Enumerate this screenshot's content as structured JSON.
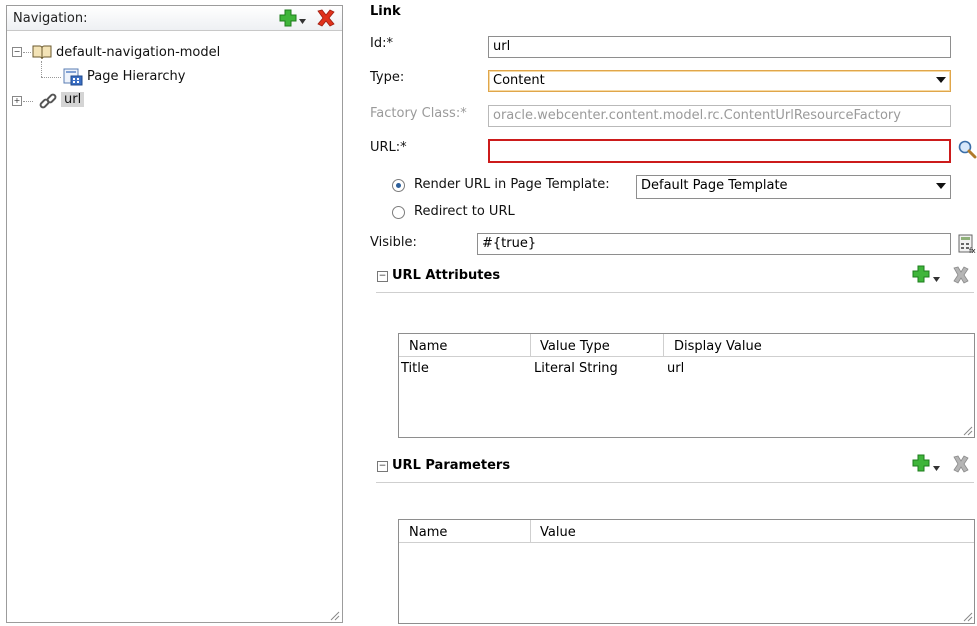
{
  "nav": {
    "title": "Navigation:",
    "tree": {
      "root_label": "default-navigation-model",
      "child1_label": "Page Hierarchy",
      "child2_label": "url"
    }
  },
  "form": {
    "section_title": "Link",
    "id_label": "Id:*",
    "id_value": "url",
    "type_label": "Type:",
    "type_value": "Content",
    "factory_label": "Factory Class:*",
    "factory_value": "oracle.webcenter.content.model.rc.ContentUrlResourceFactory",
    "url_label": "URL:*",
    "url_value": "",
    "render_option_label": "Render URL in Page Template:",
    "template_value": "Default Page Template",
    "redirect_option_label": "Redirect to URL",
    "visible_label": "Visible:",
    "visible_value": "#{true}"
  },
  "attributes": {
    "title": "URL Attributes",
    "columns": [
      "Name",
      "Value Type",
      "Display Value"
    ],
    "rows": [
      {
        "name": "Title",
        "value_type": "Literal String",
        "display_value": "url"
      }
    ]
  },
  "parameters": {
    "title": "URL Parameters",
    "columns": [
      "Name",
      "Value"
    ]
  }
}
